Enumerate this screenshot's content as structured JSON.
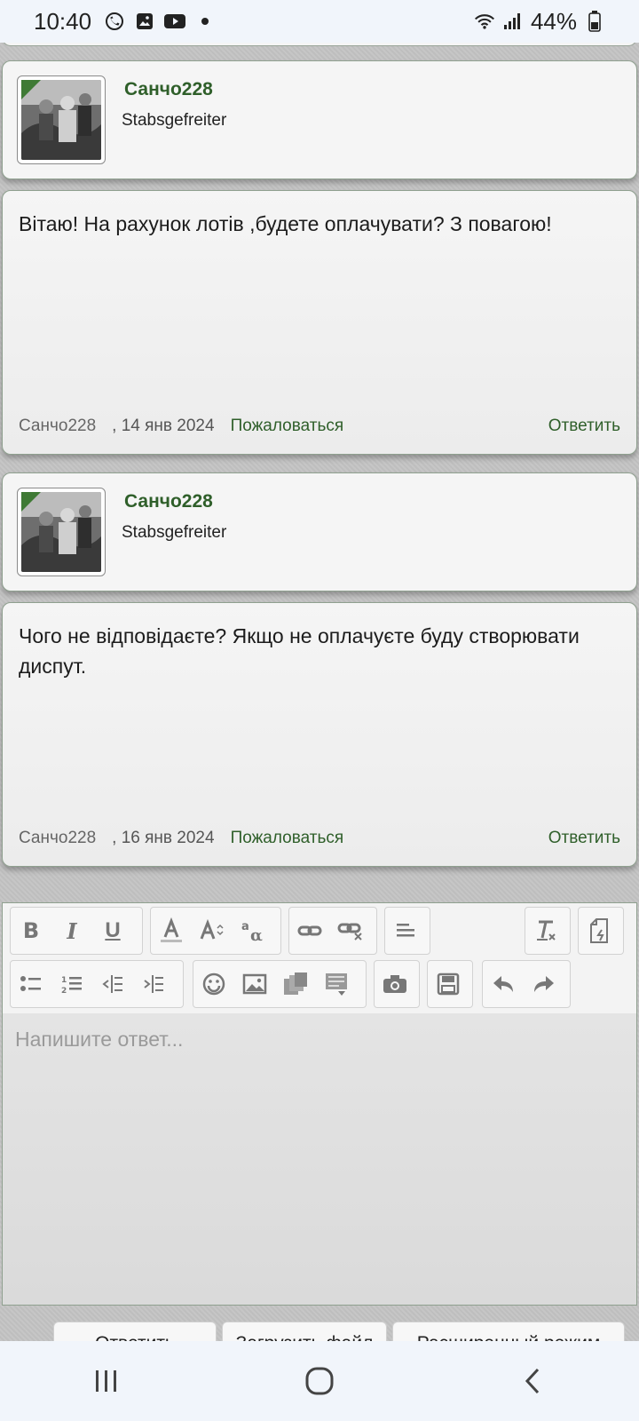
{
  "status_bar": {
    "time": "10:40",
    "battery": "44%",
    "icons": [
      "viber-icon",
      "gallery-icon",
      "youtube-icon",
      "dot-icon",
      "wifi-icon",
      "signal-icon",
      "battery-icon"
    ]
  },
  "posts": [
    {
      "author": {
        "name": "Санчо228",
        "rank": "Stabsgefreiter"
      },
      "message": "Вітаю! На рахунок лотів ,будете оплачувати? З повагою!",
      "footer": {
        "author": "Санчо228",
        "date": ", 14 янв 2024",
        "report": "Пожаловаться",
        "reply": "Ответить"
      }
    },
    {
      "author": {
        "name": "Санчо228",
        "rank": "Stabsgefreiter"
      },
      "message": "Чого не відповідаєте? Якщо не оплачуєте буду створювати диспут.",
      "footer": {
        "author": "Санчо228",
        "date": ", 16 янв 2024",
        "report": "Пожаловаться",
        "reply": "Ответить"
      }
    }
  ],
  "editor": {
    "placeholder": "Напишите ответ...",
    "toolbar_row1": [
      "bold-icon",
      "italic-icon",
      "underline-icon",
      "text-color-icon",
      "font-size-icon",
      "font-family-icon",
      "link-icon",
      "unlink-icon",
      "align-icon",
      "remove-format-icon",
      "source-mode-icon"
    ],
    "toolbar_row2": [
      "bullet-list-icon",
      "numbered-list-icon",
      "outdent-icon",
      "indent-icon",
      "smilie-icon",
      "image-icon",
      "media-icon",
      "insert-icon",
      "camera-icon",
      "save-draft-icon",
      "undo-icon",
      "redo-icon"
    ]
  },
  "actions": {
    "reply_button": "Ответить",
    "upload_button": "Загрузить файл",
    "advanced_button": "Расширенный режим"
  },
  "nav_bar": {
    "icons": [
      "recent-apps-icon",
      "home-icon",
      "back-icon"
    ]
  },
  "colors": {
    "accent_green": "#2f5f2a",
    "card_border": "#8fa08f",
    "background": "#c4c4c4"
  }
}
